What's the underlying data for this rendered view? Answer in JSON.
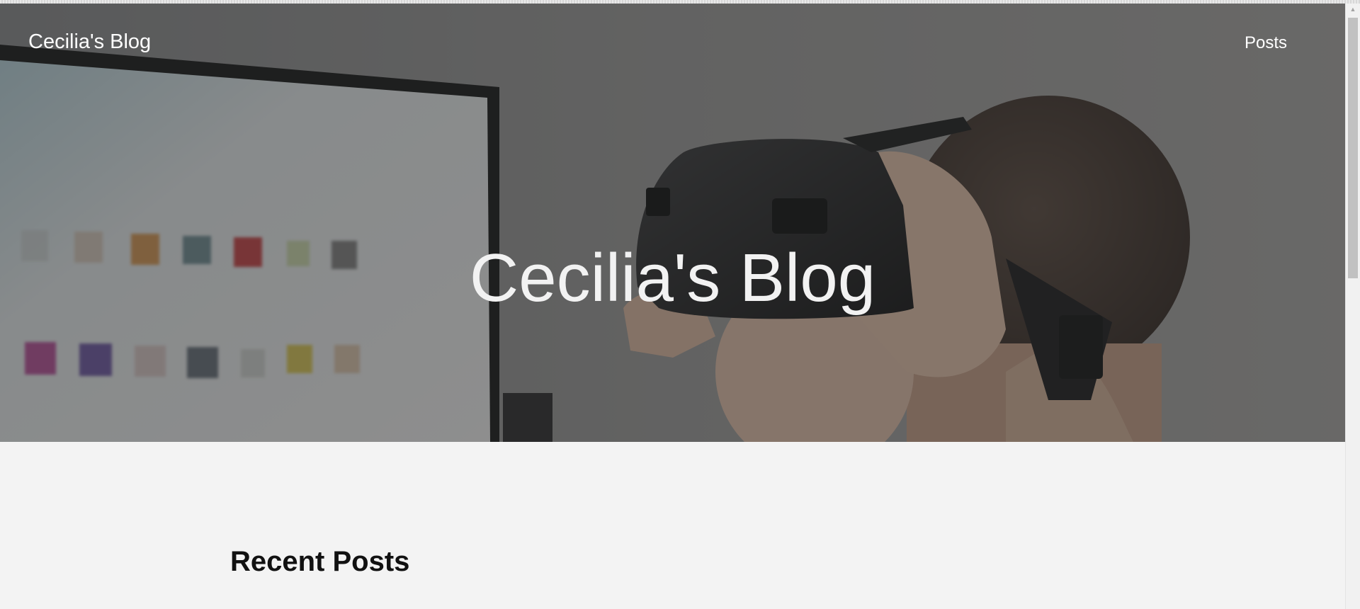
{
  "header": {
    "site_title": "Cecilia's Blog",
    "nav": [
      {
        "label": "Posts"
      }
    ]
  },
  "hero": {
    "heading": "Cecilia's Blog",
    "image": "person-wearing-vr-headset-in-front-of-monitor"
  },
  "main": {
    "recent_posts_heading": "Recent Posts"
  },
  "colors": {
    "page_background": "#f3f3f3",
    "hero_text": "#ffffff",
    "heading_text": "#111111"
  },
  "scrollbar": {
    "up_icon": "triangle-up-icon"
  }
}
